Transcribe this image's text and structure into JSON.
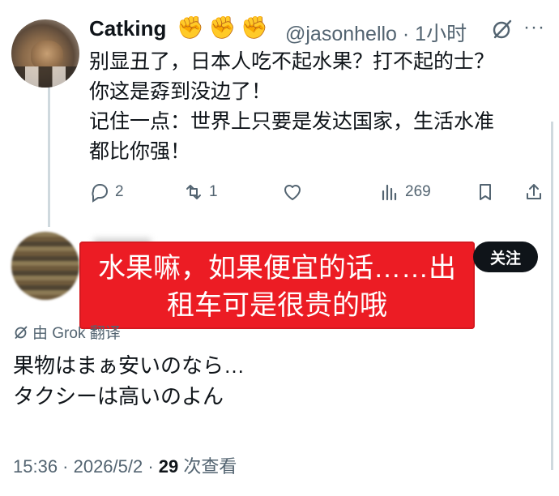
{
  "post": {
    "author_name": "Catking",
    "author_emoji": "✊✊✊",
    "handle_time": "@jasonhello · 1小时",
    "more_label": "···",
    "body": "别显丑了，日本人吃不起水果？打不起的士？\n你这是孬到没边了！\n记住一点：世界上只要是发达国家，生活水准\n都比你强！",
    "actions": {
      "reply_count": "2",
      "repost_count": "1",
      "like_count": "",
      "view_count": "269"
    }
  },
  "reply": {
    "follow_label": "关注",
    "red_overlay_text": "水果嘛，如果便宜的话……出\n租车可是很贵的哦",
    "translated_by": "由 Grok 翻译",
    "body": "果物はまぁ安いのなら…\nタクシーは高いのよん",
    "meta_prefix": "15:36 · 2026/5/2 · ",
    "views_number": "29",
    "views_suffix": " 次查看"
  },
  "colors": {
    "text": "#0f1419",
    "secondary": "#536471",
    "overlay_red": "#ec1c24",
    "follow_bg": "#0f1419"
  },
  "icons": [
    "grok-icon",
    "reply-icon",
    "repost-icon",
    "like-icon",
    "views-icon",
    "bookmark-icon",
    "share-icon",
    "translate-icon"
  ]
}
